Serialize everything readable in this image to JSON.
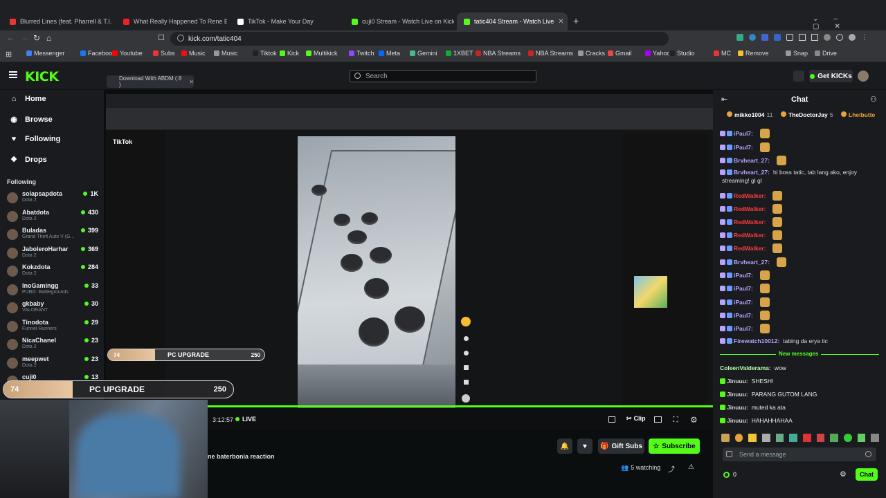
{
  "browser": {
    "tabs": [
      {
        "label": "Blurred Lines (feat. Pharrell & T.I.",
        "color": "#e33"
      },
      {
        "label": "What Really Happened To Rene Bate",
        "color": "#e22"
      },
      {
        "label": "TikTok - Make Your Day",
        "color": "#fff"
      },
      {
        "label": "cuji0 Stream - Watch Live on Kick",
        "color": "#53fc18"
      },
      {
        "label": "tatic404 Stream - Watch Live",
        "color": "#53fc18"
      }
    ],
    "url": "kick.com/tatic404",
    "bookmarks": [
      "Messenger",
      "Facebook",
      "Youtube",
      "Subs",
      "Music",
      "Music",
      "Tiktok",
      "Kick",
      "Multikick",
      "Twitch",
      "Meta",
      "Gemini",
      "1XBET",
      "NBA Streams",
      "NBA Streams",
      "Cracks",
      "Gmail",
      "Yahoo",
      "Studio",
      "MC",
      "Remove",
      "Snap",
      "Drive"
    ]
  },
  "kick": {
    "logo": "KICK",
    "search_placeholder": "Search",
    "get_kicks": "Get KICKs",
    "download_btn": "Download With ABDM ( 8 )",
    "nav": [
      "Home",
      "Browse",
      "Following",
      "Drops"
    ],
    "following_header": "Following",
    "following": [
      {
        "name": "solapsapdota",
        "game": "Dota 2",
        "count": "1K"
      },
      {
        "name": "Abatdota",
        "game": "Dota 2",
        "count": "430"
      },
      {
        "name": "Buladas",
        "game": "Grand Theft Auto V (G...",
        "count": "399"
      },
      {
        "name": "JaboleroHarhar",
        "game": "Dota 2",
        "count": "369"
      },
      {
        "name": "Kokzdota",
        "game": "Dota 2",
        "count": "284"
      },
      {
        "name": "InoGamingg",
        "game": "PUBG: Battlegrounds",
        "count": "33"
      },
      {
        "name": "gkbaby",
        "game": "VALORANT",
        "count": "30"
      },
      {
        "name": "Tinodota",
        "game": "Funnel Runners",
        "count": "29"
      },
      {
        "name": "NicaChanel",
        "game": "Dota 2",
        "count": "23"
      },
      {
        "name": "meepwet",
        "game": "Dota 2",
        "count": "23"
      },
      {
        "name": "cuji0",
        "game": "",
        "count": "13"
      }
    ]
  },
  "stream": {
    "live_label": "LIVE",
    "time": "3:12:57",
    "title": "ne baterbonia reaction",
    "goal_small": {
      "left": "74",
      "label": "PC UPGRADE",
      "right": "250",
      "fill": 0.3
    },
    "goal_big": {
      "left": "74",
      "label": "PC UPGRADE",
      "right": "250",
      "fill": 0.3
    },
    "clip": "Clip",
    "gift_subs": "Gift Subs",
    "subscribe": "Subscribe",
    "watching": "5 watching"
  },
  "chat": {
    "title": "Chat",
    "top_gifters": [
      {
        "name": "mikko1004",
        "count": "11"
      },
      {
        "name": "TheDoctorJay",
        "count": "5"
      },
      {
        "name": "Lheibutte",
        "count": ""
      }
    ],
    "messages": [
      {
        "user": "iPaul7:",
        "text": "",
        "color": "#b8a3ff",
        "emote": true
      },
      {
        "user": "iPaul7:",
        "text": "",
        "color": "#b8a3ff",
        "emote": true
      },
      {
        "user": "Brvheart_27:",
        "text": "",
        "color": "#b8a3ff",
        "emote": true
      },
      {
        "user": "Brvheart_27:",
        "text": "hi boss tatic, tab lang ako, enjoy",
        "color": "#b8a3ff",
        "emote": false
      },
      {
        "user": "",
        "text": "streaming! gl gl",
        "color": "#ddd",
        "emote": false
      },
      {
        "user": "RedWalker:",
        "text": "",
        "color": "#ff3b3b",
        "emote": true
      },
      {
        "user": "RedWalker:",
        "text": "",
        "color": "#ff3b3b",
        "emote": true
      },
      {
        "user": "RedWalker:",
        "text": "",
        "color": "#ff3b3b",
        "emote": true
      },
      {
        "user": "RedWalker:",
        "text": "",
        "color": "#ff3b3b",
        "emote": true
      },
      {
        "user": "RedWalker:",
        "text": "",
        "color": "#ff3b3b",
        "emote": true
      },
      {
        "user": "Brvheart_27:",
        "text": "",
        "color": "#b8a3ff",
        "emote": true
      },
      {
        "user": "iPaul7:",
        "text": "",
        "color": "#b8a3ff",
        "emote": true
      },
      {
        "user": "iPaul7:",
        "text": "",
        "color": "#b8a3ff",
        "emote": true
      },
      {
        "user": "iPaul7:",
        "text": "",
        "color": "#b8a3ff",
        "emote": true
      },
      {
        "user": "iPaul7:",
        "text": "",
        "color": "#b8a3ff",
        "emote": true
      },
      {
        "user": "iPaul7:",
        "text": "",
        "color": "#b8a3ff",
        "emote": true
      },
      {
        "user": "Firewatch10012:",
        "text": "tabing da erya tic",
        "color": "#b8a3ff",
        "emote": false
      }
    ],
    "new_messages": "New messages",
    "new": [
      {
        "user": "ColeenValderama:",
        "text": "wow",
        "color": "#b8ffb0"
      },
      {
        "user": "Jinuuu:",
        "text": "SHESH!",
        "color": "#d6d6d6"
      },
      {
        "user": "Jinuuu:",
        "text": "PARANG GUTOM LANG",
        "color": "#d6d6d6"
      },
      {
        "user": "Jinuuu:",
        "text": "muted ka ata",
        "color": "#d6d6d6"
      },
      {
        "user": "Jinuuu:",
        "text": "HAHAHHAHAA",
        "color": "#d6d6d6"
      }
    ],
    "input_placeholder": "Send a message",
    "kicks_count": "0",
    "chat_button": "Chat"
  }
}
